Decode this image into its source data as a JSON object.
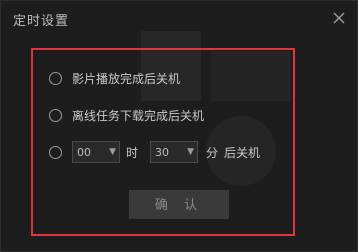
{
  "window": {
    "title": "定时设置"
  },
  "options": {
    "after_playback": "影片播放完成后关机",
    "after_download": "离线任务下载完成后关机"
  },
  "timer": {
    "hour_value": "00",
    "hour_unit": "时",
    "minute_value": "30",
    "minute_unit": "分",
    "suffix": "后关机"
  },
  "buttons": {
    "confirm": "确 认"
  },
  "colors": {
    "highlight_border": "#e0363b",
    "background": "#1d1d1d"
  },
  "icons": {
    "close": "close-icon",
    "dropdown": "chevron-down-icon"
  }
}
